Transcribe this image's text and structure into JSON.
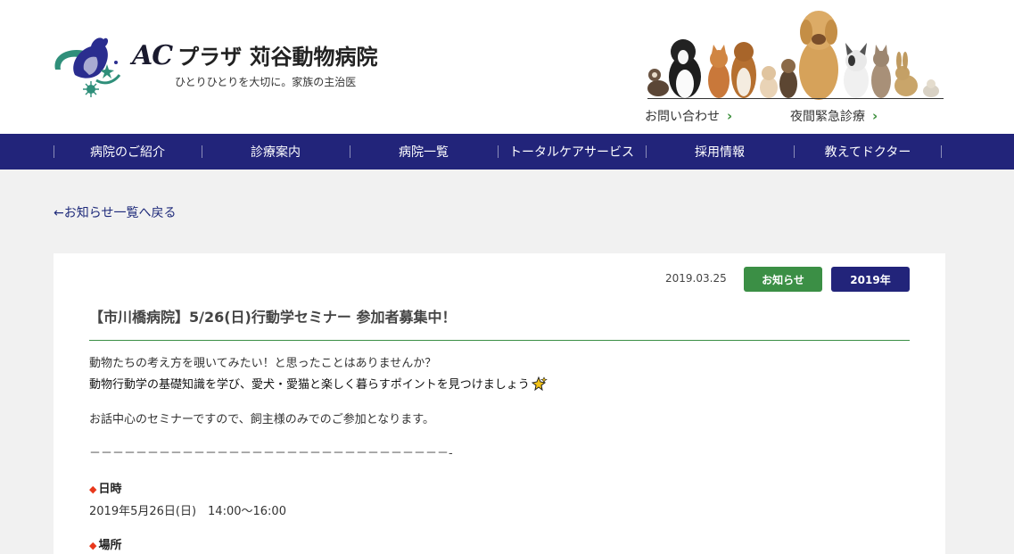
{
  "header": {
    "brand_ac": "AC",
    "brand_name": "プラザ 苅谷動物病院",
    "tagline": "ひとりひとりを大切に。家族の主治医",
    "contact_link": "お問い合わせ",
    "night_link": "夜間緊急診療"
  },
  "nav": {
    "items": [
      {
        "label": "病院のご紹介"
      },
      {
        "label": "診療案内"
      },
      {
        "label": "病院一覧"
      },
      {
        "label": "トータルケアサービス"
      },
      {
        "label": "採用情報"
      },
      {
        "label": "教えてドクター"
      }
    ]
  },
  "back_link": "←お知らせ一覧へ戻る",
  "article": {
    "date": "2019.03.25",
    "category": "お知らせ",
    "year": "2019年",
    "title": "【市川橋病院】5/26(日)行動学セミナー 参加者募集中！",
    "para1": "動物たちの考え方を覗いてみたい！と思ったことはありませんか？",
    "para2": "動物行動学の基礎知識を学び、愛犬・愛猫と楽しく暮らすポイントを見つけましょう",
    "para3": "お話中心のセミナーですので、飼主様のみでのご参加となります。",
    "divider": "－－－－－－－－－－－－－－－－－－－－－－－－－－－－－－－-",
    "sections": [
      {
        "marker": "◆",
        "label": "日時",
        "value": "2019年5月26日(日)　14:00〜16:00"
      },
      {
        "marker": "◆",
        "label": "場所"
      }
    ]
  },
  "colors": {
    "nav_bg": "#22247a",
    "accent_green": "#3b8f45",
    "marker_red": "#e8381b",
    "page_bg": "#f1f1f1"
  }
}
